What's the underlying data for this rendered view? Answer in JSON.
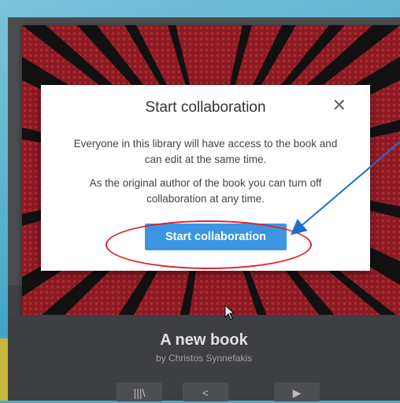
{
  "dialog": {
    "title": "Start collaboration",
    "close_glyph": "✕",
    "paragraph_1": "Everyone in this library will have access to the book and can edit at the same time.",
    "paragraph_2": "As the original author of the book you can turn off collaboration at any time.",
    "primary_button": "Start collaboration"
  },
  "book": {
    "title": "A new book",
    "author": "by Christos Synnefakis"
  },
  "actions": [
    {
      "icon": "library-icon",
      "glyph": "|||\\"
    },
    {
      "icon": "share-icon",
      "glyph": "<"
    },
    {
      "icon": "play-icon",
      "glyph": "▶"
    }
  ],
  "colors": {
    "primary_button": "#3c95e3",
    "annotation_ellipse": "#e0202a",
    "annotation_arrow": "#1f6fc9",
    "cover": "#8c1a22"
  }
}
